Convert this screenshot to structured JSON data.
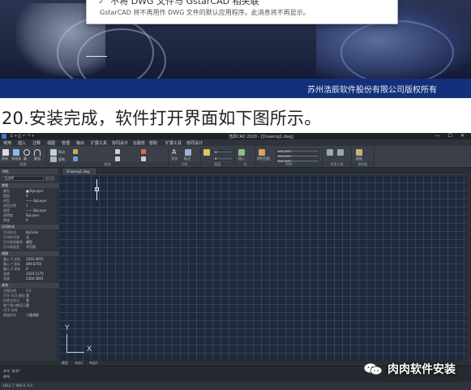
{
  "installer": {
    "dialog_line1": "不将 DWG 文件与 GstarCAD 相关联",
    "dialog_line2": "GstarCAD 将不再用作 DWG 文件的默认应用程序。此消息将不再显示。",
    "copyright": "苏州浩辰软件股份有限公司版权所有",
    "brand_color": "#13307a"
  },
  "caption": "20.安装完成，软件打开界面如下图所示。",
  "app": {
    "title": "浩辰CAD 2020 - [Drawing1.dwg]",
    "quick_access": "☰ ▾ ⎙ ↶ ↷ ▾",
    "window_buttons": "— ☐ ✕",
    "menus": [
      "常用",
      "插入",
      "注释",
      "视图",
      "管理",
      "输出",
      "扩展工具",
      "协同设计",
      "云服务",
      "帮助",
      "扩展工具",
      "协同设计"
    ],
    "ribbon_groups": [
      "绘图",
      "修改",
      "注释",
      "图层",
      "块",
      "特性",
      "实用工具",
      "剪贴板"
    ],
    "ribbon_tool_labels": [
      "直线",
      "多段线",
      "圆",
      "圆弧",
      "移动",
      "复制",
      "文字",
      "标注",
      "插入",
      "特性匹配",
      "粘贴"
    ],
    "layer_combo": "0",
    "bylayer_combo": "ByLayer",
    "document_tab": "Drawing1.dwg",
    "properties": {
      "header": "特性",
      "selection": "无选择",
      "sections": [
        {
          "title": "常规",
          "rows": [
            {
              "k": "颜色",
              "v": "■ ByLayer"
            },
            {
              "k": "图层",
              "v": "0"
            },
            {
              "k": "线型",
              "v": "—— ByLayer"
            },
            {
              "k": "线型比例",
              "v": "1"
            },
            {
              "k": "线宽",
              "v": "—— ByLayer"
            },
            {
              "k": "透明度",
              "v": "ByLayer"
            },
            {
              "k": "厚度",
              "v": "0"
            }
          ]
        },
        {
          "title": "打印样式",
          "rows": [
            {
              "k": "打印样式",
              "v": "ByColor"
            },
            {
              "k": "打印样式表",
              "v": "无"
            },
            {
              "k": "打印表附着到",
              "v": "模型"
            },
            {
              "k": "打印表类型",
              "v": "不可用"
            }
          ]
        },
        {
          "title": "视图",
          "rows": [
            {
              "k": "圆心 X 坐标",
              "v": "1010.4925"
            },
            {
              "k": "圆心 Y 坐标",
              "v": "489.8750"
            },
            {
              "k": "圆心 Z 坐标",
              "v": "0"
            },
            {
              "k": "高度",
              "v": "1024.1170"
            },
            {
              "k": "宽度",
              "v": "2304.3001"
            }
          ]
        },
        {
          "title": "其他",
          "rows": [
            {
              "k": "注释比例",
              "v": "1:1"
            },
            {
              "k": "打开 UCS 图标",
              "v": "是"
            },
            {
              "k": "在原点显示",
              "v": "是"
            },
            {
              "k": "每个视口都显示",
              "v": "是"
            },
            {
              "k": "UCS 名称",
              "v": ""
            },
            {
              "k": "视觉样式",
              "v": "二维线框"
            }
          ]
        }
      ]
    },
    "ucs_y": "Y",
    "ucs_x": "X",
    "layout_tabs": [
      "模型",
      "布局1",
      "布局2"
    ],
    "command_history": "命令: 取消*",
    "command_prompt": "命令:",
    "status_coords": "1812.7, 990.0, 0.0"
  },
  "watermark": "肉肉软件安装",
  "colors": {
    "canvas_bg": "#1e2a3b",
    "ui_dark": "#2a2e35"
  }
}
